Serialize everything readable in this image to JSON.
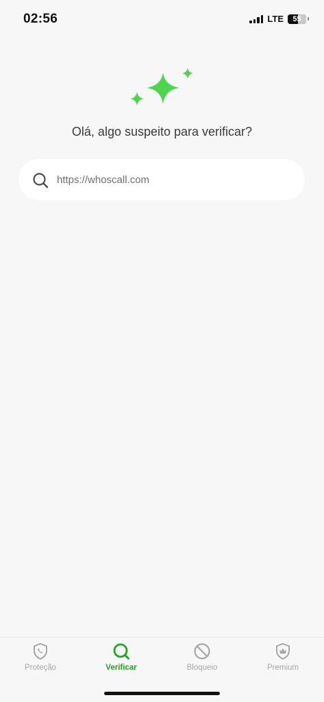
{
  "status_bar": {
    "time": "02:56",
    "network": "LTE",
    "battery": "55",
    "battery_level_percent": 55
  },
  "main": {
    "greeting": "Olá, algo suspeito para verificar?",
    "search": {
      "placeholder": "https://whoscall.com",
      "value": ""
    }
  },
  "tabs": [
    {
      "label": "Proteção",
      "icon": "shield-phone-icon",
      "active": false
    },
    {
      "label": "Verificar",
      "icon": "search-icon",
      "active": true
    },
    {
      "label": "Bloqueio",
      "icon": "block-icon",
      "active": false
    },
    {
      "label": "Premium",
      "icon": "crown-shield-icon",
      "active": false
    }
  ],
  "colors": {
    "accent": "#1fa51f",
    "sparkle": "#4fd44f",
    "inactive": "#a6a6a6",
    "background": "#f7f7f7"
  }
}
